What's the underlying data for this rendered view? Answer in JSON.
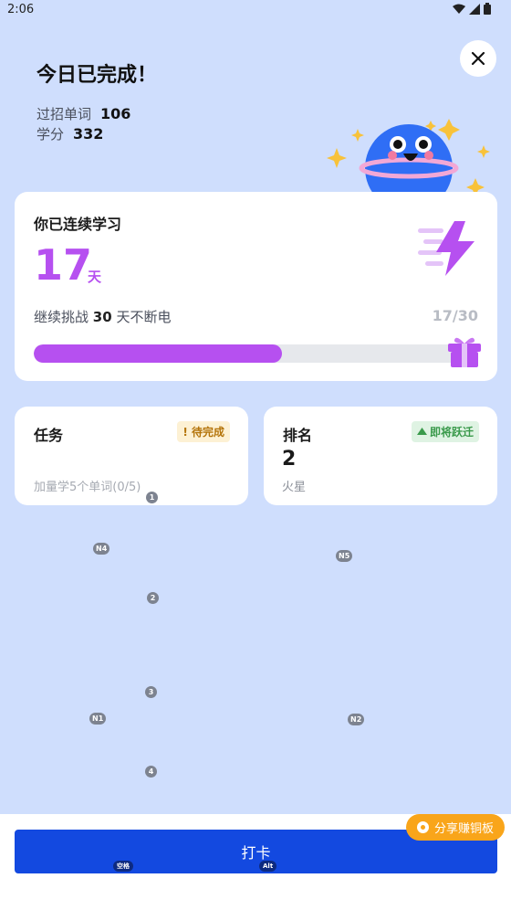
{
  "status_bar": {
    "time": "2:06"
  },
  "header": {
    "title": "今日已完成！",
    "words_label": "过招单词",
    "words_value": "106",
    "credit_label": "学分",
    "credit_value": "332"
  },
  "streak": {
    "title": "你已连续学习",
    "days": "17",
    "unit": "天",
    "challenge_prefix": "继续挑战",
    "challenge_days": "30",
    "challenge_suffix": "天不断电",
    "progress_text": "17/30",
    "progress_fraction": 0.5667
  },
  "task": {
    "title": "任务",
    "badge": "! 待完成",
    "desc": "加量学5个单词(0/5)"
  },
  "rank": {
    "title": "排名",
    "badge": "即将跃迁",
    "value": "2",
    "planet": "火星"
  },
  "markers": [
    "1",
    "N4",
    "N5",
    "2",
    "3",
    "N1",
    "N2",
    "4"
  ],
  "bottom": {
    "checkin_label": "打卡",
    "share_label": "分享赚铜板",
    "key_space": "空格",
    "key_alt": "Alt"
  },
  "colors": {
    "background": "#cfdefd",
    "accent_purple": "#b650f0",
    "primary_blue": "#1349e0",
    "share_orange": "#f9a51a"
  },
  "icons": [
    "wifi-icon",
    "signal-icon",
    "battery-icon",
    "close-icon",
    "planet-mascot",
    "lightning-icon",
    "gift-icon",
    "up-arrow-icon",
    "coin-icon"
  ]
}
